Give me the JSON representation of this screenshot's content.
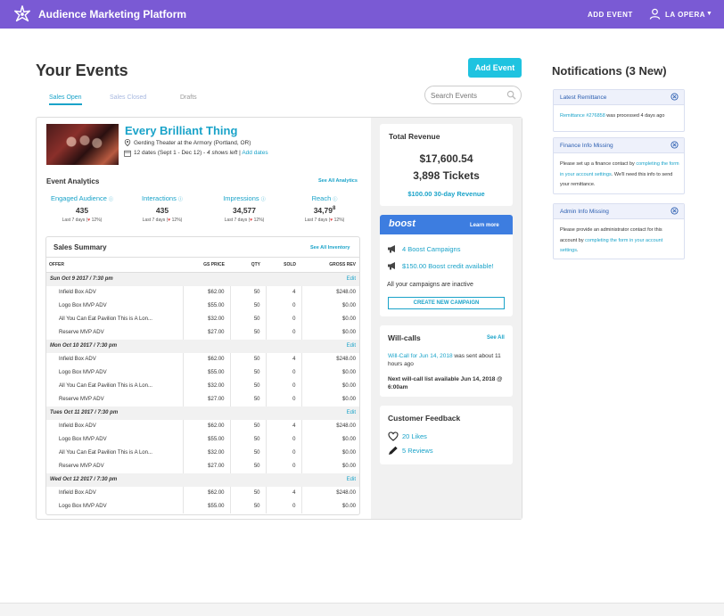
{
  "app": {
    "brand": "Audience Marketing Platform",
    "add_event": "ADD EVENT",
    "user": "LA OPERA",
    "caret": "▼"
  },
  "page": {
    "title": "Your Events",
    "add_event_button": "Add Event"
  },
  "tabs": [
    {
      "label": "Sales Open"
    },
    {
      "label": "Sales Closed"
    },
    {
      "label": "Drafts"
    }
  ],
  "search": {
    "placeholder": "Search Events"
  },
  "event": {
    "title": "Every Brilliant Thing",
    "venue": "Gerding Theater at the Armory (Portland, OR)",
    "dates_prefix": "12 dates (Sept 1 - Dec 12) -",
    "dates_em": "4 shows left",
    "dates_sep": "|",
    "dates_link": "Add dates"
  },
  "analytics": {
    "title": "Event Analytics",
    "see_all": "See All Analytics",
    "stats": [
      {
        "label": "Engaged Audience",
        "value": "435",
        "sub_prefix": "Last 7 days (",
        "sub_heart": "♥",
        "sub_suffix": " 12%)"
      },
      {
        "label": "Interactions",
        "value": "435",
        "sub_prefix": "Last 7 days (",
        "sub_heart": "♥",
        "sub_suffix": " 12%)"
      },
      {
        "label": "Impressions",
        "value": "34,577",
        "sub_prefix": "Last 7 days (",
        "sub_heart": "♥",
        "sub_suffix": " 12%)"
      },
      {
        "label": "Reach",
        "value": "34,79",
        "value_sup": "8",
        "sub_prefix": "Last 7 days (",
        "sub_heart": "♥",
        "sub_suffix": " 12%)"
      }
    ],
    "info_glyph": "ⓘ"
  },
  "sales": {
    "title": "Sales Summary",
    "see_all": "See All Inventory",
    "columns": [
      "OFFER",
      "GS PRICE",
      "QTY",
      "SOLD",
      "GROSS REV"
    ],
    "edit_label": "Edit",
    "groups": [
      {
        "date": "Sun Oct 9 2017 / 7:30 pm",
        "rows": [
          [
            "Infield Box ADV",
            "$62.00",
            "50",
            "4",
            "$248.00"
          ],
          [
            "Logo Box MVP ADV",
            "$55.00",
            "50",
            "0",
            "$0.00"
          ],
          [
            "All You Can Eat Pavilion This is A Lon...",
            "$32.00",
            "50",
            "0",
            "$0.00"
          ],
          [
            "Reserve MVP ADV",
            "$27.00",
            "50",
            "0",
            "$0.00"
          ]
        ]
      },
      {
        "date": "Mon Oct 10 2017 / 7:30 pm",
        "rows": [
          [
            "Infield Box ADV",
            "$62.00",
            "50",
            "4",
            "$248.00"
          ],
          [
            "Logo Box MVP ADV",
            "$55.00",
            "50",
            "0",
            "$0.00"
          ],
          [
            "All You Can Eat Pavilion This is A Lon...",
            "$32.00",
            "50",
            "0",
            "$0.00"
          ],
          [
            "Reserve MVP ADV",
            "$27.00",
            "50",
            "0",
            "$0.00"
          ]
        ]
      },
      {
        "date": "Tues Oct 11 2017 / 7:30 pm",
        "rows": [
          [
            "Infield Box ADV",
            "$62.00",
            "50",
            "4",
            "$248.00"
          ],
          [
            "Logo Box MVP ADV",
            "$55.00",
            "50",
            "0",
            "$0.00"
          ],
          [
            "All You Can Eat Pavilion This is A Lon...",
            "$32.00",
            "50",
            "0",
            "$0.00"
          ],
          [
            "Reserve MVP ADV",
            "$27.00",
            "50",
            "0",
            "$0.00"
          ]
        ]
      },
      {
        "date": "Wed Oct 12 2017 / 7:30 pm",
        "rows": [
          [
            "Infield Box ADV",
            "$62.00",
            "50",
            "4",
            "$248.00"
          ],
          [
            "Logo Box MVP ADV",
            "$55.00",
            "50",
            "0",
            "$0.00"
          ]
        ]
      }
    ]
  },
  "revenue": {
    "title": "Total Revenue",
    "amount": "$17,600.54",
    "tickets": "3,898 Tickets",
    "boost_revenue": "$100.00 30-day Revenue"
  },
  "boost": {
    "logo": "boost",
    "learn_more": "Learn more",
    "campaigns": "4 Boost Campaigns",
    "credit": "$150.00 Boost credit available!",
    "inactive": "All your campaigns are inactive",
    "create": "CREATE NEW CAMPAIGN"
  },
  "willcalls": {
    "title": "Will-calls",
    "see_all": "See All",
    "link": "Will-Call for Jun 14, 2018",
    "desc": " was sent about 11 hours ago",
    "next": "Next will-call list available Jun 14, 2018 @ 6:00am"
  },
  "feedback": {
    "title": "Customer Feedback",
    "likes": "20 Likes",
    "reviews": "5 Reviews"
  },
  "notifications": {
    "title": "Notifications (3 New)",
    "items": [
      {
        "head": "Latest Remittance",
        "link": "Remittance #276858",
        "text_after": " was processed 4 days ago"
      },
      {
        "head": "Finance Info Missing",
        "text_before": "Please set up a finance contact by ",
        "link": "completing the form in your account settings",
        "text_after": ". We'll need this info to send your remittance."
      },
      {
        "head": "Admin Info Missing",
        "text_before": "Please provide an administrator contact for this account by ",
        "link": "completing the form in your account settings",
        "text_after": "."
      }
    ]
  },
  "colors": {
    "topbar": "#7a5ad4",
    "accent": "#1aa3c9",
    "add_button": "#1fc3e0",
    "boost": "#3d7de0"
  },
  "icons": {
    "logo": "star-flower-icon",
    "user": "user-icon",
    "search": "search-icon",
    "pin": "map-pin-icon",
    "calendar": "calendar-icon",
    "megaphone": "megaphone-icon",
    "heart": "heart-icon",
    "pencil": "pencil-icon",
    "close": "close-circle-icon"
  }
}
